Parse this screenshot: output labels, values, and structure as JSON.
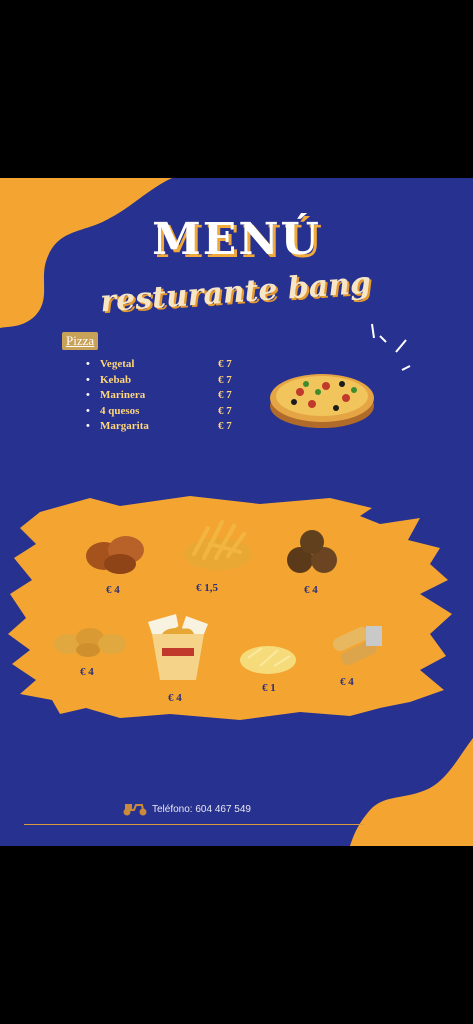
{
  "header": {
    "title": "MENÚ",
    "subtitle": "resturante bang"
  },
  "pizza_section": {
    "label": "Pizza",
    "items": [
      {
        "name": "Vegetal",
        "price": "€ 7"
      },
      {
        "name": "Kebab",
        "price": "€ 7"
      },
      {
        "name": "Marinera",
        "price": "€ 7"
      },
      {
        "name": "4 quesos",
        "price": "€ 7"
      },
      {
        "name": "Margarita",
        "price": "€ 7"
      }
    ]
  },
  "extras": {
    "wings_price": "€ 4",
    "fries_price": "€ 1,5",
    "meatballs_price": "€ 4",
    "nuggets_price": "€ 4",
    "noodles_price": "€ 4",
    "cheese_price": "€ 1",
    "rolls_price": "€ 4"
  },
  "footer": {
    "phone": "Teléfono: 604 467 549"
  },
  "colors": {
    "background": "#27318f",
    "accent": "#f4a531"
  }
}
